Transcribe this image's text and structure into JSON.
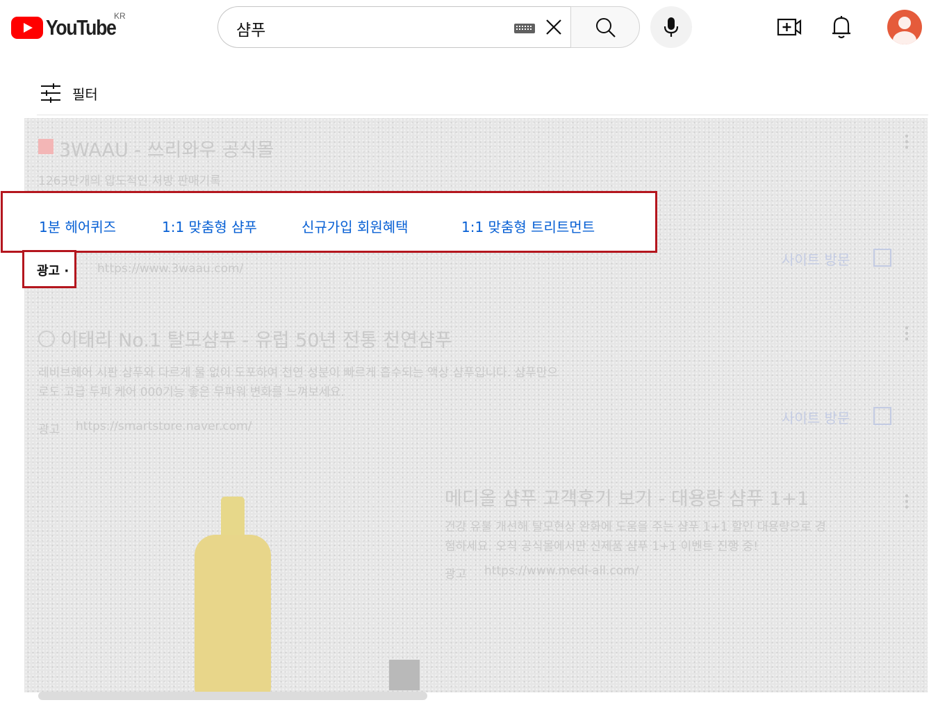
{
  "header": {
    "logo_text": "YouTube",
    "country_code": "KR",
    "search": {
      "value": "샴푸"
    },
    "icons": [
      "keyboard-icon",
      "clear-icon",
      "search-icon",
      "mic-icon",
      "create-icon",
      "bell-icon",
      "avatar"
    ]
  },
  "filter": {
    "label": "필터"
  },
  "ads": [
    {
      "advertiser": "3WAAU - 쓰리와우 공식몰",
      "description": "1263만개의 압도적인 처방 판매기록",
      "sitelinks": [
        "1분 헤어퀴즈",
        "1:1 맞춤형 샴푸",
        "신규가입 회원혜택",
        "1:1 맞춤형 트리트먼트"
      ],
      "ad_label": "광고 ·",
      "url": "https://www.3waau.com/",
      "visit_label": "사이트 방문"
    },
    {
      "title": "이태리 No.1 탈모샴푸 - 유럽 50년 전통 천연샴푸",
      "description_line1": "레비브헤어 시판 샴푸와 다르게 물 없이 도포하여 천연 성분이 빠르게 흡수되는 액상 샴푸입니다. 샴푸만으",
      "description_line2": "로도 고급 두피 케어 000기능 좋은 무파워 변화를 느껴보세요.",
      "ad_label": "광고",
      "url": "https://smartstore.naver.com/",
      "visit_label": "사이트 방문"
    },
    {
      "title": "메디올 샴푸 고객후기 보기 - 대용량 샴푸 1+1",
      "description_line1": "건강 유불 개선해 탈모현상 완화에 도움을 주는 샴푸 1+1 할인 대용량으로 경",
      "description_line2": "험하세요. 오직 공식몰에서만 신제품 샴푸 1+1 이벤트 진행 중!",
      "ad_label": "광고",
      "url": "https://www.medi-all.com/"
    }
  ],
  "colors": {
    "highlight": "#b4161e",
    "link": "#065fd4",
    "brand_red": "#ff0000"
  }
}
